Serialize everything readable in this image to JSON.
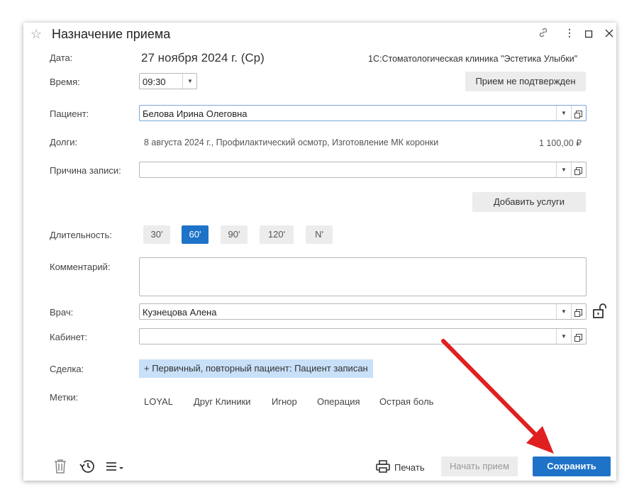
{
  "window": {
    "title": "Назначение приема",
    "org": "1С:Стоматологическая клиника \"Эстетика Улыбки\""
  },
  "labels": {
    "date": "Дата:",
    "time": "Время:",
    "patient": "Пациент:",
    "debts": "Долги:",
    "reason": "Причина записи:",
    "duration": "Длительность:",
    "comment": "Комментарий:",
    "doctor": "Врач:",
    "cabinet": "Кабинет:",
    "deal": "Сделка:",
    "tags": "Метки:"
  },
  "values": {
    "date": "27 ноября 2024 г. (Ср)",
    "time": "09:30",
    "patient": "Белова Ирина Олеговна",
    "debts_text": "8 августа 2024 г., Профилактический осмотр, Изготовление МК коронки",
    "debts_amount": "1 100,00 ₽",
    "reason": "",
    "comment": "",
    "doctor": "Кузнецова Алена",
    "cabinet": "",
    "deal": "+ Первичный, повторный пациент: Пациент записан"
  },
  "buttons": {
    "not_confirmed": "Прием не подтвержден",
    "add_services": "Добавить услуги",
    "print": "Печать",
    "start": "Начать прием",
    "save": "Сохранить"
  },
  "durations": [
    "30'",
    "60'",
    "90'",
    "120'",
    "N'"
  ],
  "selected_duration": "60'",
  "tags": [
    "LOYAL",
    "Друг Клиники",
    "Игнор",
    "Операция",
    "Острая боль"
  ],
  "colors": {
    "accent": "#1e73c8",
    "deal_bg": "#c8e0f8",
    "arrow": "#e02020"
  }
}
